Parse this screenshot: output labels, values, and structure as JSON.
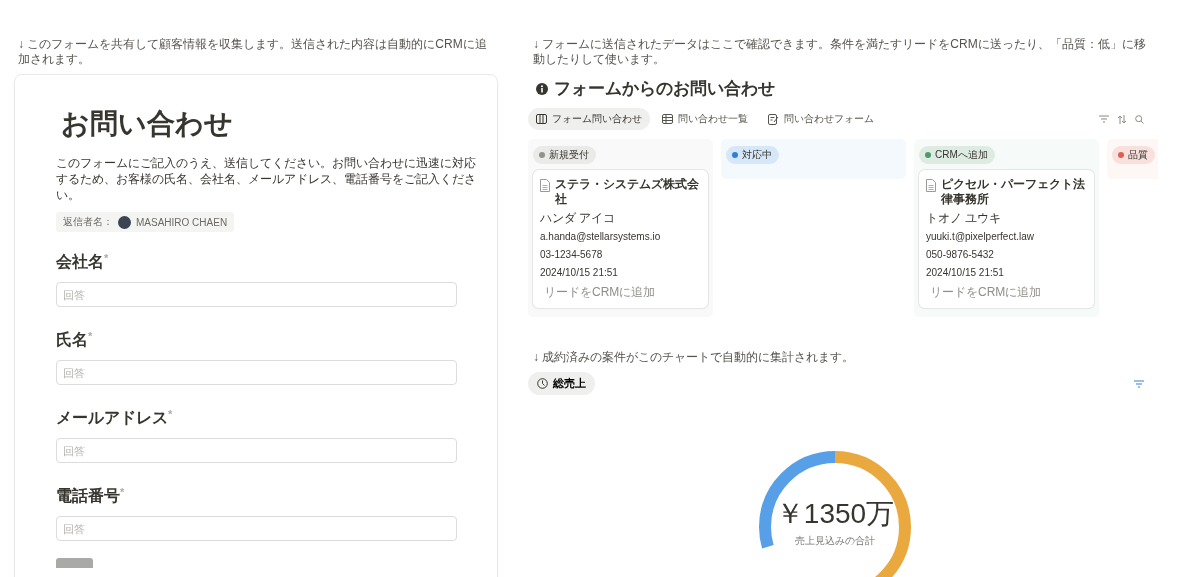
{
  "form_intro": "↓ このフォームを共有して顧客情報を収集します。送信された内容は自動的にCRMに追加されます。",
  "form": {
    "title": "お問い合わせ",
    "description": "このフォームにご記入のうえ、送信してください。お問い合わせに迅速に対応するため、お客様の氏名、会社名、メールアドレス、電話番号をご記入ください。",
    "responder_label": "返信者名：",
    "responder_name": "MASAHIRO CHAEN",
    "fields": [
      {
        "label": "会社名",
        "required_mark": "*",
        "placeholder": "回答"
      },
      {
        "label": "氏名",
        "required_mark": "*",
        "placeholder": "回答"
      },
      {
        "label": "メールアドレス",
        "required_mark": "*",
        "placeholder": "回答"
      },
      {
        "label": "電話番号",
        "required_mark": "*",
        "placeholder": "回答"
      }
    ]
  },
  "database_intro": "↓ フォームに送信されたデータはここで確認できます。条件を満たすリードをCRMに送ったり、「品質：低」に移動したりして使います。",
  "database": {
    "title": "フォームからのお問い合わせ",
    "views": [
      {
        "label": "フォーム問い合わせ",
        "kind": "board",
        "selected": true
      },
      {
        "label": "問い合わせ一覧",
        "kind": "table",
        "selected": false
      },
      {
        "label": "問い合わせフォーム",
        "kind": "form",
        "selected": false
      }
    ],
    "groups": [
      {
        "label": "新規受付",
        "color": "#91918e",
        "cards": [
          {
            "title": "ステラ・システムズ株式会社",
            "name": "ハンダ アイコ",
            "email": "a.handa@stellarsystems.io",
            "phone": "03-1234-5678",
            "date": "2024/10/15 21:51",
            "action": "リードをCRMに追加"
          }
        ]
      },
      {
        "label": "対応中",
        "color": "#2f80d8"
      },
      {
        "label": "CRMへ追加",
        "color": "#4f9a6d",
        "cards": [
          {
            "title": "ピクセル・パーフェクト法律事務所",
            "name": "トオノ ユウキ",
            "email": "yuuki.t@pixelperfect.law",
            "phone": "050-9876-5432",
            "date": "2024/10/15 21:51",
            "action": "リードをCRMに追加"
          }
        ]
      },
      {
        "label": "品質",
        "color": "#e05d52"
      }
    ]
  },
  "chart_intro": "↓ 成約済みの案件がこのチャートで自動的に集計されます。",
  "chart": {
    "view_label": "総売上",
    "value": "￥1350万",
    "caption": "売上見込みの合計"
  }
}
